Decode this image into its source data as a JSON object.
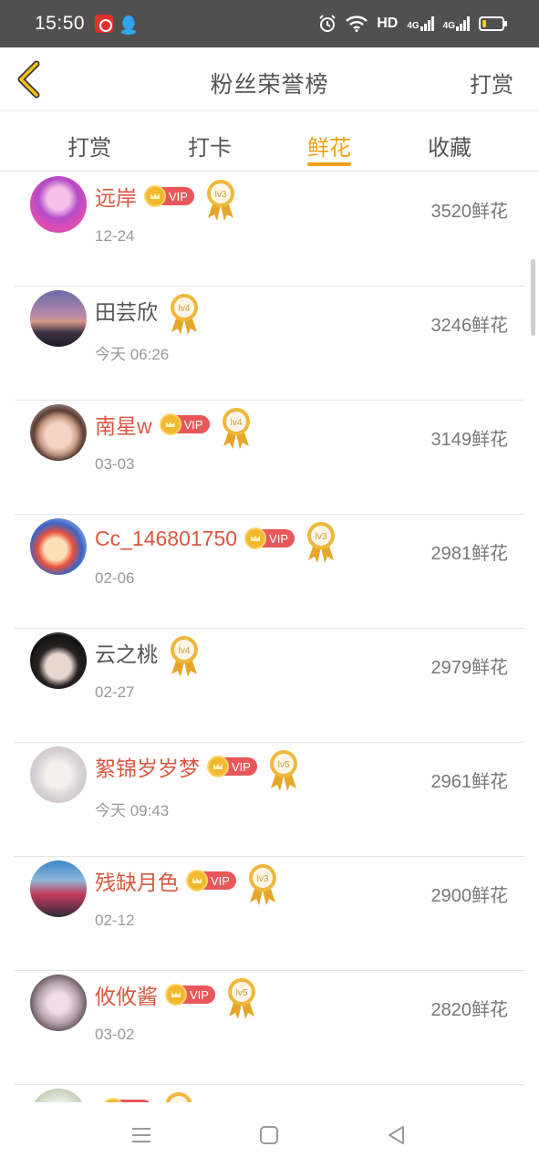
{
  "status_bar": {
    "time": "15:50",
    "network_label": "HD",
    "signal_label_1": "4G",
    "signal_label_2": "4G",
    "battery_level": 0.2
  },
  "header": {
    "title": "粉丝荣誉榜",
    "right_action": "打赏",
    "back_icon": "chevron-left-icon"
  },
  "tabs": [
    {
      "label": "打赏",
      "active": false
    },
    {
      "label": "打卡",
      "active": false
    },
    {
      "label": "鲜花",
      "active": true
    },
    {
      "label": "收藏",
      "active": false
    }
  ],
  "rows": [
    {
      "name": "远岸",
      "vip": true,
      "vip_label": "VIP",
      "level": "lv3",
      "date": "12-24",
      "amount": "3520鲜花"
    },
    {
      "name": "田芸欣",
      "vip": false,
      "vip_label": "",
      "level": "lv4",
      "date": "今天 06:26",
      "amount": "3246鲜花"
    },
    {
      "name": "南星w",
      "vip": true,
      "vip_label": "VIP",
      "level": "lv4",
      "date": "03-03",
      "amount": "3149鲜花"
    },
    {
      "name": "Cc_146801750",
      "vip": true,
      "vip_label": "VIP",
      "level": "lv3",
      "date": "02-06",
      "amount": "2981鲜花"
    },
    {
      "name": "云之桃",
      "vip": false,
      "vip_label": "",
      "level": "lv4",
      "date": "02-27",
      "amount": "2979鲜花"
    },
    {
      "name": "絮锦岁岁梦",
      "vip": true,
      "vip_label": "VIP",
      "level": "lv5",
      "date": "今天 09:43",
      "amount": "2961鲜花"
    },
    {
      "name": "残缺月色",
      "vip": true,
      "vip_label": "VIP",
      "level": "lv3",
      "date": "02-12",
      "amount": "2900鲜花"
    },
    {
      "name": "攸攸酱",
      "vip": true,
      "vip_label": "VIP",
      "level": "lv5",
      "date": "03-02",
      "amount": "2820鲜花"
    },
    {
      "name": "",
      "vip": true,
      "vip_label": "VIP",
      "level": "",
      "date": "",
      "amount": ""
    }
  ],
  "colors": {
    "accent": "#f0a119",
    "vip_name": "#d9573f",
    "vip_badge": "#e8585a",
    "statusbar": "#505050"
  }
}
